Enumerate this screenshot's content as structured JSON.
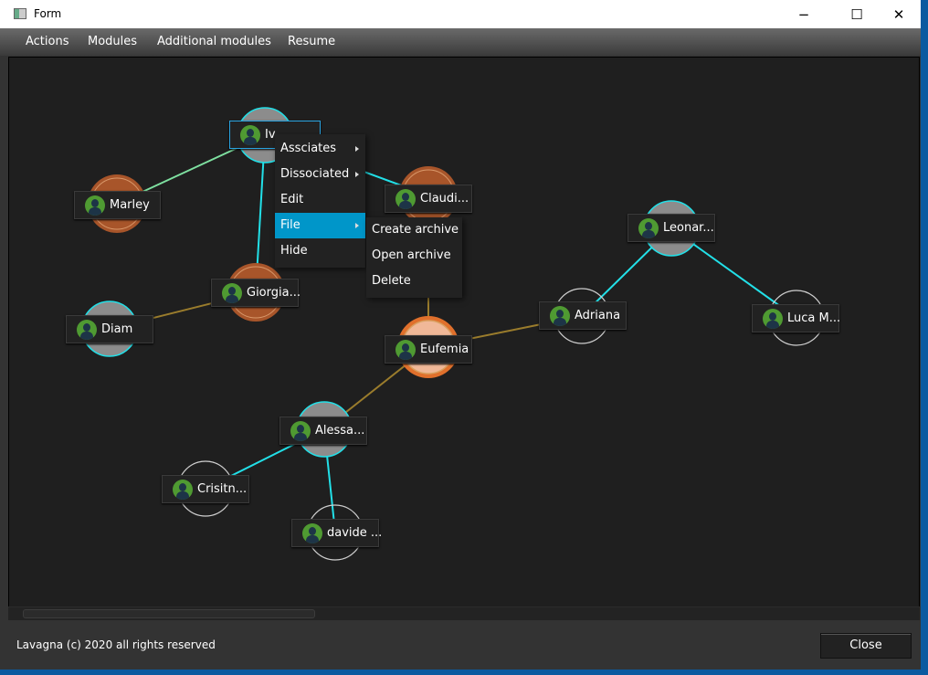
{
  "window": {
    "title": "Form",
    "minimize": "−",
    "maximize": "☐",
    "close": "✕"
  },
  "menubar": [
    "Actions",
    "Modules",
    "Additional modules",
    "Resume"
  ],
  "colors": {
    "cyan_edge": "#22e0e8",
    "green_edge": "#7ee0a0",
    "gold_edge": "#9a7c2c",
    "orange_node": "#a8552a",
    "gray_node": "#8c8c8c",
    "menu_highlight": "#0096c9",
    "avatar": "#4f9a32"
  },
  "nodes": [
    {
      "id": "iv",
      "label": "Iv",
      "type": "gray",
      "selected": true
    },
    {
      "id": "marley",
      "label": "Marley",
      "type": "orange"
    },
    {
      "id": "claudi",
      "label": "Claudi...",
      "type": "orange"
    },
    {
      "id": "leonar",
      "label": "Leonar...",
      "type": "gray"
    },
    {
      "id": "giorgia",
      "label": "Giorgia...",
      "type": "orange"
    },
    {
      "id": "diam",
      "label": "Diam",
      "type": "gray"
    },
    {
      "id": "adriana",
      "label": "Adriana",
      "type": "outline"
    },
    {
      "id": "luca",
      "label": "Luca M...",
      "type": "outline"
    },
    {
      "id": "eufemia",
      "label": "Eufemia",
      "type": "light-orange"
    },
    {
      "id": "alessa",
      "label": "Alessa...",
      "type": "gray"
    },
    {
      "id": "crisitn",
      "label": "Crisitn...",
      "type": "outline"
    },
    {
      "id": "davide",
      "label": "davide ...",
      "type": "outline"
    }
  ],
  "edges": [
    [
      "iv",
      "marley",
      "green"
    ],
    [
      "iv",
      "giorgia",
      "cyan"
    ],
    [
      "iv",
      "claudi",
      "cyan"
    ],
    [
      "giorgia",
      "diam",
      "gold"
    ],
    [
      "claudi",
      "eufemia",
      "gold"
    ],
    [
      "eufemia",
      "adriana",
      "gold"
    ],
    [
      "eufemia",
      "alessa",
      "gold"
    ],
    [
      "alessa",
      "crisitn",
      "cyan"
    ],
    [
      "alessa",
      "davide",
      "cyan"
    ],
    [
      "leonar",
      "adriana",
      "cyan"
    ],
    [
      "leonar",
      "luca",
      "cyan"
    ]
  ],
  "context_menu": {
    "items": [
      {
        "label": "Assciates",
        "submenu": true
      },
      {
        "label": "Dissociated",
        "submenu": true
      },
      {
        "label": "Edit",
        "submenu": false
      },
      {
        "label": "File",
        "submenu": true,
        "highlighted": true
      },
      {
        "label": "Hide",
        "submenu": false
      }
    ]
  },
  "file_submenu": {
    "items": [
      "Create archive",
      "Open archive",
      "Delete"
    ]
  },
  "footer": {
    "copyright": "Lavagna (c) 2020 all rights reserved",
    "close_label": "Close"
  }
}
